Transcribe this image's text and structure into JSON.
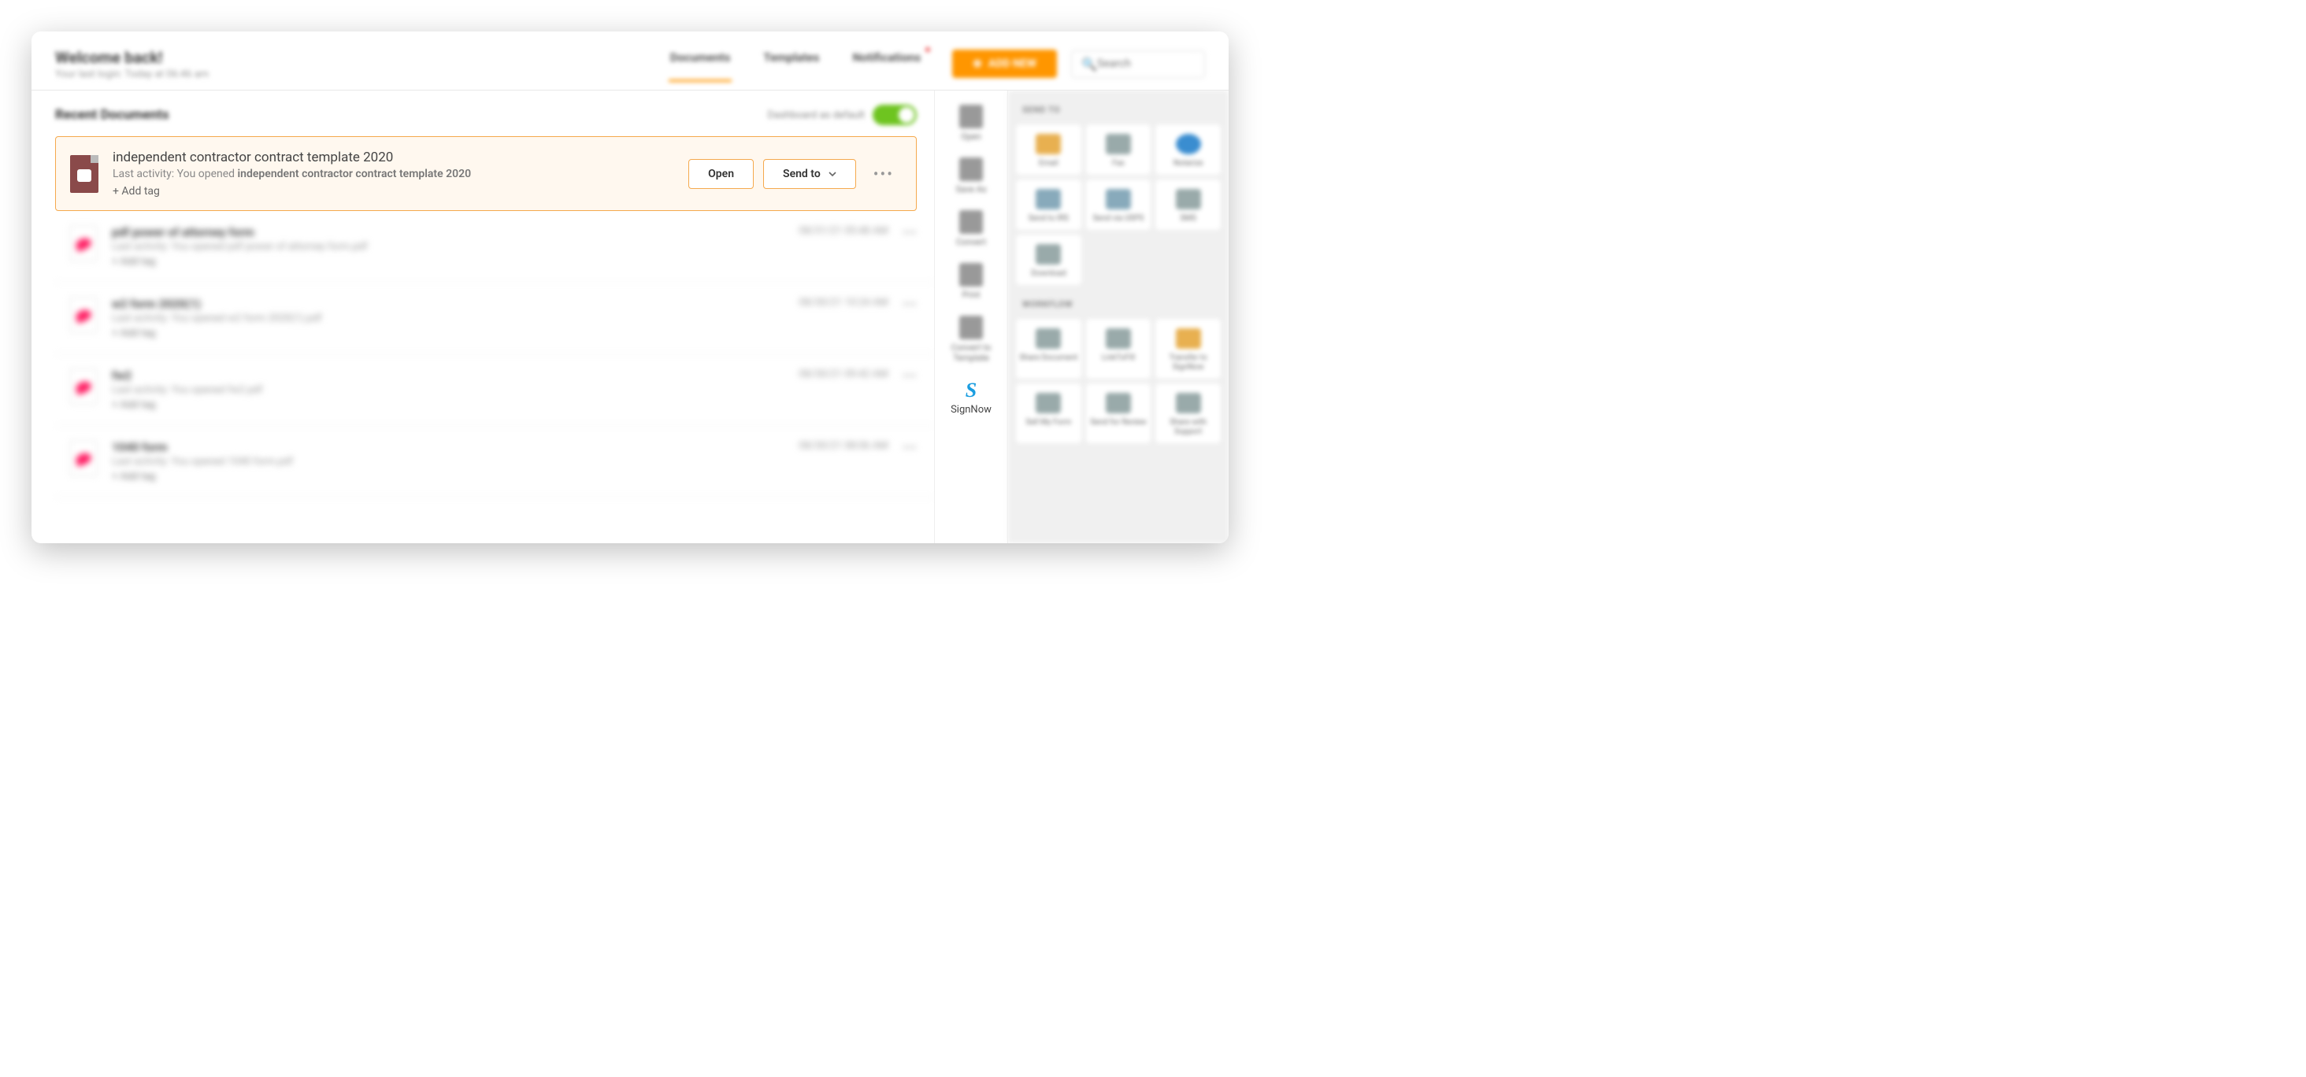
{
  "header": {
    "welcome_title": "Welcome back!",
    "welcome_sub": "Your last login: Today at 06:46 am",
    "tabs": {
      "documents": "Documents",
      "templates": "Templates",
      "notifications": "Notifications"
    },
    "add_new": "ADD NEW",
    "search_placeholder": "Search"
  },
  "section": {
    "title": "Recent Documents",
    "dashboard_default": "Dashboard as default",
    "toggle_on": "ON"
  },
  "featured": {
    "title": "independent contractor contract template 2020",
    "activity_prefix": "Last activity: You opened ",
    "activity_bold": "independent contractor contract template 2020",
    "add_tag": "+ Add tag",
    "open": "Open",
    "send_to": "Send to",
    "more": "•••"
  },
  "rows": [
    {
      "title": "pdf power of attorney form",
      "sub": "Last activity: You opened pdf power of attorney form.pdf",
      "tag": "+ Add tag",
      "date": "08/31/21 05:48 AM",
      "more": "•••"
    },
    {
      "title": "w2 form 2020(1)",
      "sub": "Last activity: You opened w2 form 2020(1).pdf",
      "tag": "+ Add tag",
      "date": "08/30/21 10:24 AM",
      "more": "•••"
    },
    {
      "title": "fw2",
      "sub": "Last activity: You opened fw2.pdf",
      "tag": "+ Add tag",
      "date": "08/30/21 09:42 AM",
      "more": "•••"
    },
    {
      "title": "1040 form",
      "sub": "Last activity: You opened 1040 form.pdf",
      "tag": "+ Add tag",
      "date": "08/30/21 08:06 AM",
      "more": "•••"
    }
  ],
  "side": {
    "open": "Open",
    "save_as": "Save As",
    "convert": "Convert",
    "print": "Print",
    "convert_template": "Convert to Template",
    "signnow": "SignNow"
  },
  "panel": {
    "send_to_label": "SEND TO",
    "workflow_label": "WORKFLOW",
    "send_items": [
      {
        "label": "Email"
      },
      {
        "label": "Fax"
      },
      {
        "label": "Notarize"
      },
      {
        "label": "Send to IRS"
      },
      {
        "label": "Send via USPS"
      },
      {
        "label": "SMS"
      },
      {
        "label": "Download"
      }
    ],
    "workflow_items": [
      {
        "label": "Share Document"
      },
      {
        "label": "LinkToFill"
      },
      {
        "label": "Transfer to SignNow"
      },
      {
        "label": "Sell My Form"
      },
      {
        "label": "Send for Review"
      },
      {
        "label": "Share with Support"
      }
    ]
  }
}
